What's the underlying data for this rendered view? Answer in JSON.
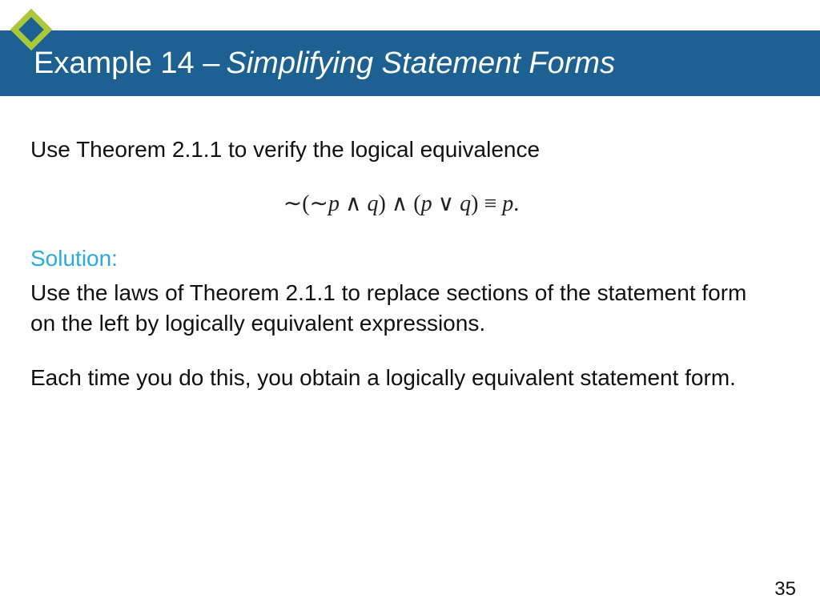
{
  "header": {
    "example_label": "Example 14 –",
    "subtitle": "Simplifying Statement Forms"
  },
  "body": {
    "intro": "Use Theorem 2.1.1 to verify the logical equivalence",
    "formula_text": "∼(∼p ∧ q) ∧ (p ∨ q) ≡ p.",
    "solution_label": "Solution:",
    "para1": "Use the laws of Theorem 2.1.1 to replace sections of the statement form on the left by logically equivalent expressions.",
    "para2": "Each time you do this, you obtain a logically equivalent statement form."
  },
  "page_number": "35",
  "colors": {
    "title_bg": "#1c6192",
    "accent": "#29abe2",
    "diamond_border": "#a9c93a",
    "diamond_fill": "#1c6192"
  }
}
